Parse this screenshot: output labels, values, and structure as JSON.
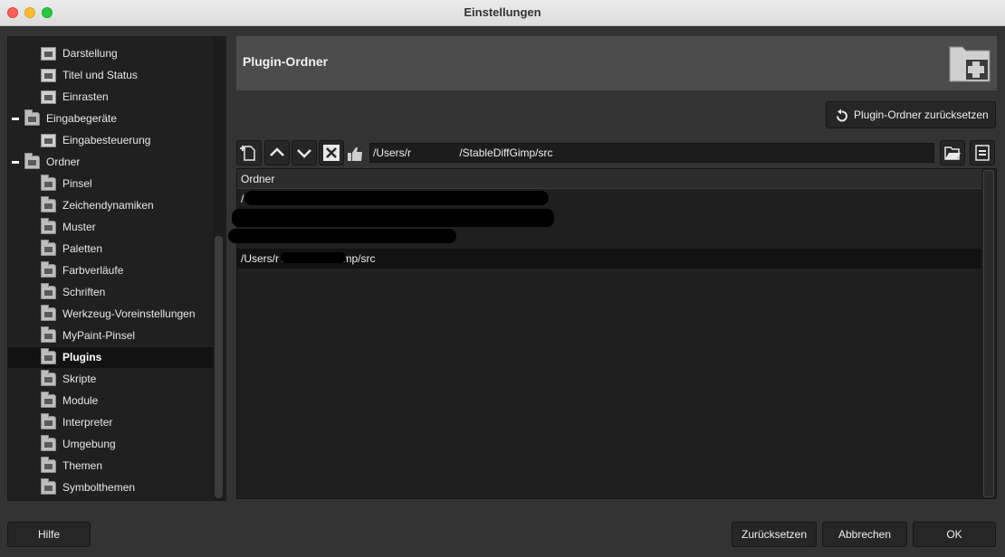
{
  "window": {
    "title": "Einstellungen"
  },
  "sidebar": {
    "items": [
      {
        "label": "Darstellung",
        "type": "page",
        "level": 2
      },
      {
        "label": "Titel und Status",
        "type": "page",
        "level": 2
      },
      {
        "label": "Einrasten",
        "type": "page",
        "level": 2
      },
      {
        "label": "Eingabegeräte",
        "type": "group",
        "level": 1,
        "expanded": true
      },
      {
        "label": "Eingabesteuerung",
        "type": "page",
        "level": 2
      },
      {
        "label": "Ordner",
        "type": "group",
        "level": 1,
        "expanded": true
      },
      {
        "label": "Pinsel",
        "type": "folder",
        "level": 2
      },
      {
        "label": "Zeichendynamiken",
        "type": "folder",
        "level": 2
      },
      {
        "label": "Muster",
        "type": "folder",
        "level": 2
      },
      {
        "label": "Paletten",
        "type": "folder",
        "level": 2
      },
      {
        "label": "Farbverläufe",
        "type": "folder",
        "level": 2
      },
      {
        "label": "Schriften",
        "type": "folder",
        "level": 2
      },
      {
        "label": "Werkzeug-Voreinstellungen",
        "type": "folder",
        "level": 2
      },
      {
        "label": "MyPaint-Pinsel",
        "type": "folder",
        "level": 2
      },
      {
        "label": "Plugins",
        "type": "folder",
        "level": 2,
        "selected": true
      },
      {
        "label": "Skripte",
        "type": "folder",
        "level": 2
      },
      {
        "label": "Module",
        "type": "folder",
        "level": 2
      },
      {
        "label": "Interpreter",
        "type": "folder",
        "level": 2
      },
      {
        "label": "Umgebung",
        "type": "folder",
        "level": 2
      },
      {
        "label": "Themen",
        "type": "folder",
        "level": 2
      },
      {
        "label": "Symbolthemen",
        "type": "folder",
        "level": 2
      }
    ]
  },
  "main": {
    "title": "Plugin-Ordner",
    "header_icon": "plugin-folder-icon",
    "reset_button": "Plugin-Ordner zurücksetzen",
    "toolbar_icons": [
      "new-folder-icon",
      "move-up-icon",
      "move-down-icon",
      "delete-icon",
      "writable-thumb-icon"
    ],
    "path_value": "/Users/r                /StableDiffGimp/src",
    "browse_icon": "open-folder-icon",
    "edit_icon": "document-icon",
    "list": {
      "column_header": "Ordner",
      "rows": [
        {
          "text": "/"
        },
        {
          "text": ""
        },
        {
          "text": ""
        },
        {
          "text": "/Users/r                /StableDiffGimp/src",
          "selected": true
        }
      ]
    }
  },
  "footer": {
    "help": "Hilfe",
    "reset": "Zurücksetzen",
    "cancel": "Abbrechen",
    "ok": "OK"
  },
  "colors": {
    "background": "#333333",
    "panel_dark": "#1f1f1f",
    "header": "#4c4c4c",
    "selection": "#121212"
  }
}
